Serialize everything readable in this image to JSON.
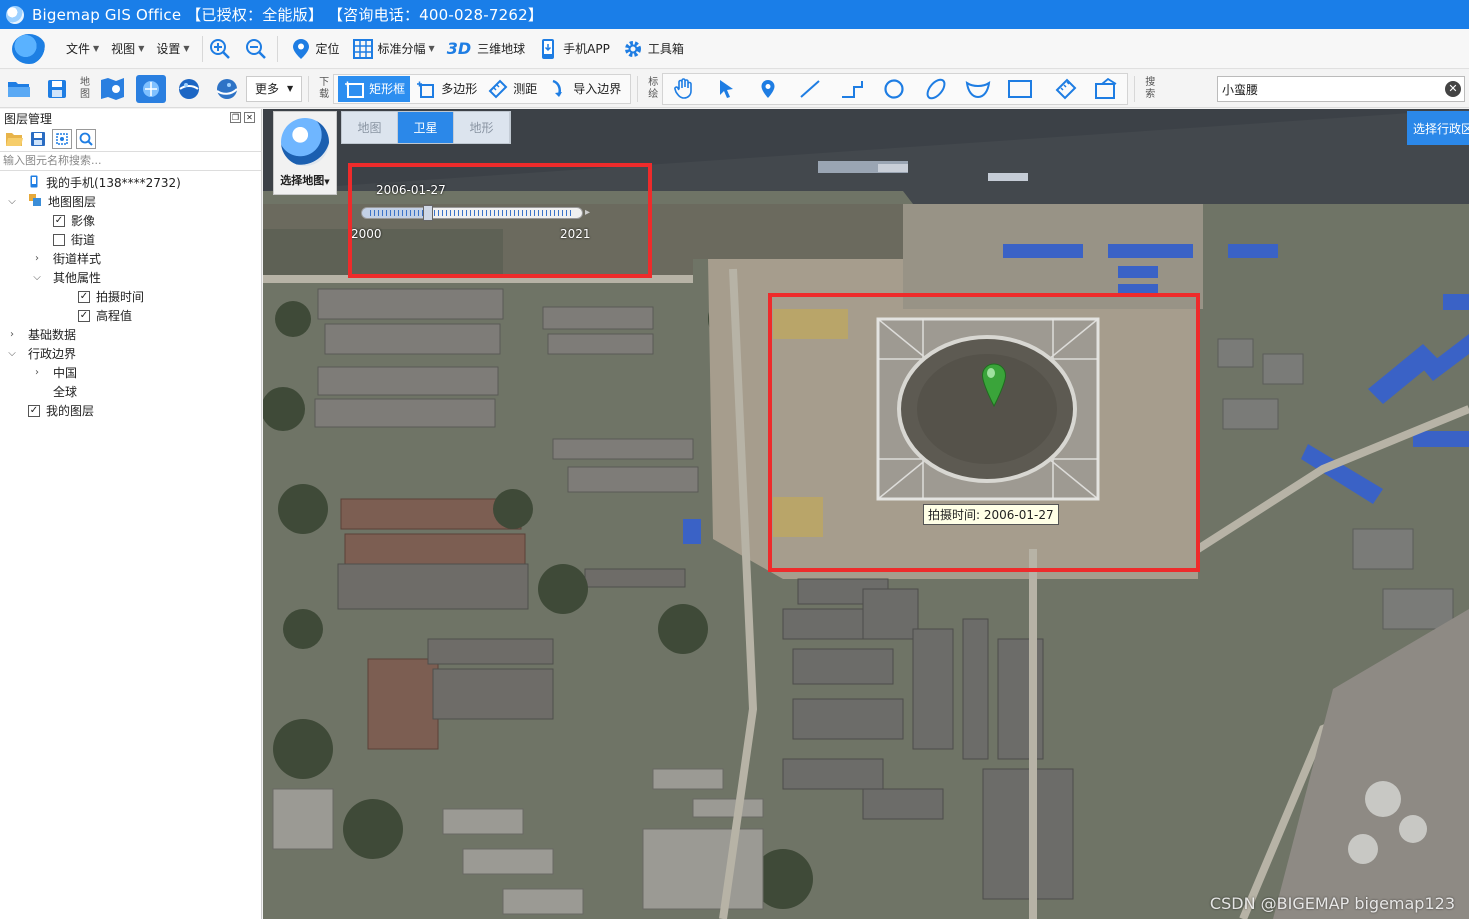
{
  "window": {
    "title": "Bigemap GIS Office 【已授权：全能版】 【咨询电话：400-028-7262】"
  },
  "menu": {
    "file": "文件",
    "view": "视图",
    "settings": "设置",
    "locate": "定位",
    "standard_grid": "标准分幅",
    "globe_3d_badge": "3D",
    "globe_3d": "三维地球",
    "mobile_app": "手机APP",
    "toolbox": "工具箱"
  },
  "toolbar": {
    "map_label": "地图",
    "more": "更多",
    "download_label": "下载",
    "rect_box": "矩形框",
    "polygon": "多边形",
    "measure": "测距",
    "import_border": "导入边界",
    "annotate_label": "标绘",
    "search_label": "搜索",
    "search_value": "小蛮腰"
  },
  "left_panel": {
    "title": "图层管理",
    "search_placeholder": "输入图元名称搜索...",
    "tree": [
      {
        "label": "我的手机(138****2732)"
      },
      {
        "label": "地图图层"
      },
      {
        "label": "影像",
        "checked": true
      },
      {
        "label": "街道",
        "checked": false
      },
      {
        "label": "街道样式"
      },
      {
        "label": "其他属性"
      },
      {
        "label": "拍摄时间",
        "checked": true
      },
      {
        "label": "高程值",
        "checked": true
      },
      {
        "label": "基础数据"
      },
      {
        "label": "行政边界"
      },
      {
        "label": "中国"
      },
      {
        "label": "全球"
      },
      {
        "label": "我的图层",
        "checked": true
      }
    ]
  },
  "map": {
    "select_map": "选择地图",
    "tabs": [
      "地图",
      "卫星",
      "地形"
    ],
    "active_tab": "卫星",
    "select_region": "选择行政区",
    "timeline": {
      "current": "2006-01-27",
      "start": "2000",
      "end": "2021",
      "position": 0.29
    },
    "tooltip": "拍摄时间: 2006-01-27",
    "watermark": "CSDN @BIGEMAP bigemap123"
  },
  "colors": {
    "titlebar": "#1a7ee8",
    "accent": "#2b88e9",
    "highlight": "#ee2b2b",
    "pin": "#3aa43a"
  }
}
